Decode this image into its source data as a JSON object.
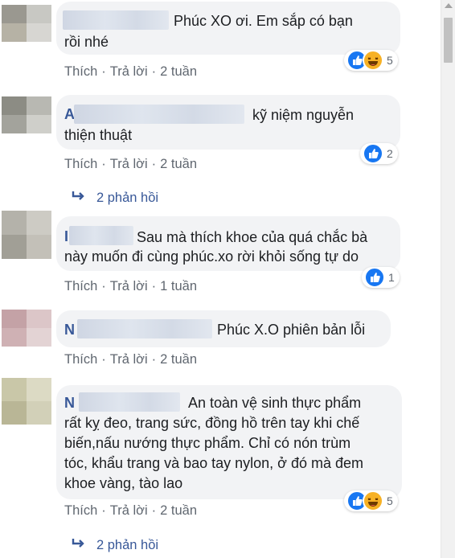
{
  "comments": [
    {
      "text_lines": [
        "Phúc XO ơi. Em sắp có bạn",
        "rồi nhé"
      ],
      "actions": {
        "like": "Thích",
        "reply": "Trả lời",
        "time": "2 tuần",
        "sep": "·"
      },
      "reactions": {
        "types": [
          "like-icon",
          "haha-icon"
        ],
        "count": "5"
      }
    },
    {
      "initial": "A",
      "text_lines": [
        "kỹ niệm nguyễn",
        "thiện thuật"
      ],
      "actions": {
        "like": "Thích",
        "reply": "Trả lời",
        "time": "2 tuần",
        "sep": "·"
      },
      "reactions": {
        "types": [
          "like-icon"
        ],
        "count": "2"
      },
      "replies": "2 phản hồi"
    },
    {
      "initial": "I",
      "text_lines": [
        "Sau mà thích khoe của quá chắc bà",
        "này muốn đi cùng phúc.xo rời khỏi sống tự do"
      ],
      "actions": {
        "like": "Thích",
        "reply": "Trả lời",
        "time": "1 tuần",
        "sep": "·"
      },
      "reactions": {
        "types": [
          "like-icon"
        ],
        "count": "1"
      }
    },
    {
      "initial": "N",
      "text_lines": [
        "Phúc X.O phiên bản lỗi"
      ],
      "actions": {
        "like": "Thích",
        "reply": "Trả lời",
        "time": "2 tuần",
        "sep": "·"
      }
    },
    {
      "initial": "N",
      "text_lines": [
        "An toàn vệ sinh thực phẩm",
        "rất kỵ đeo, trang sức, đồng hồ trên tay khi chế",
        "biến,nấu nướng thực phẩm. Chỉ có nón trùm",
        "tóc, khẩu trang và bao tay nylon, ở đó mà đem",
        "khoe vàng, tào lao"
      ],
      "actions": {
        "like": "Thích",
        "reply": "Trả lời",
        "time": "2 tuần",
        "sep": "·"
      },
      "reactions": {
        "types": [
          "like-icon",
          "haha-icon"
        ],
        "count": "5"
      },
      "replies": "2 phản hồi"
    }
  ],
  "colors": {
    "link": "#385898",
    "meta": "#606770",
    "bubble": "#f2f3f5",
    "like": "#1877f2",
    "haha": "#f7b125"
  }
}
